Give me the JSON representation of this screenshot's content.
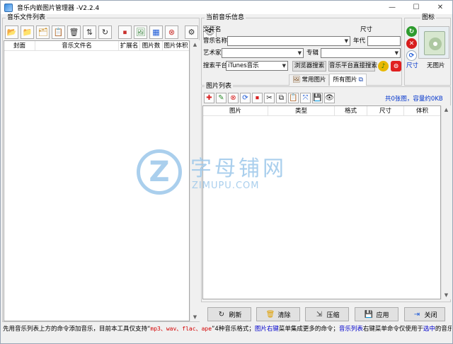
{
  "window": {
    "title": "音乐内嵌图片管理器 -V2.2.4",
    "min": "—",
    "max": "☐",
    "close": "✕"
  },
  "left_panel": {
    "legend": "音乐文件列表",
    "toolbar": [
      {
        "icon": "add-file-icon",
        "glyph": "📂"
      },
      {
        "icon": "add-folder-icon",
        "glyph": "📁"
      },
      {
        "icon": "add-folders-icon",
        "glyph": "🗂"
      },
      {
        "icon": "clipboard-icon",
        "glyph": "📋"
      },
      {
        "icon": "trash-icon",
        "glyph": "🗑"
      },
      {
        "icon": "sort-icon",
        "glyph": "⇅"
      },
      {
        "icon": "refresh-icon",
        "glyph": "↻"
      },
      {
        "icon": "stop-icon",
        "glyph": "⏹"
      },
      {
        "icon": "image-add-icon",
        "glyph": "🖼"
      },
      {
        "icon": "grid-select-icon",
        "glyph": "▦"
      },
      {
        "icon": "image-remove-icon",
        "glyph": "⊗"
      },
      {
        "icon": "gear-icon",
        "glyph": "⚙"
      },
      {
        "icon": "eye-icon",
        "glyph": "👁"
      }
    ],
    "columns": [
      "封面",
      "音乐文件名",
      "扩展名",
      "图片数",
      "图片体积"
    ]
  },
  "info_panel": {
    "legend": "当前音乐信息",
    "file_name_label": "文件名",
    "size_label": "尺寸",
    "music_name_label": "音乐名称",
    "music_name_value": "",
    "year_label": "年代",
    "year_value": "",
    "artist_label": "艺术家",
    "artist_value": "",
    "album_label": "专辑",
    "album_value": "",
    "search_platform_label": "搜索平台",
    "search_platform_value": "iTunes音乐",
    "browser_search_label": "浏览器搜索",
    "platform_direct_search_label": "音乐平台直接搜索",
    "tabs": [
      {
        "label": "常用图片",
        "active": false
      },
      {
        "label": "所有图片",
        "active": true
      }
    ]
  },
  "cover_panel": {
    "legend": "图标",
    "size_label": "尺寸",
    "no_image_label": "无图片"
  },
  "image_list": {
    "legend": "图片列表",
    "summary": "共0张图，容量约0KB",
    "toolbar": [
      {
        "icon": "plus-icon",
        "glyph": "✚",
        "color": "#d81e1e"
      },
      {
        "icon": "edit-icon",
        "glyph": "✎",
        "color": "#2e8b2e"
      },
      {
        "icon": "delete-icon",
        "glyph": "⊗",
        "color": "#d81e1e"
      },
      {
        "icon": "link-icon",
        "glyph": "⟳",
        "color": "#1e5bd8"
      },
      {
        "icon": "stop-icon",
        "glyph": "⏹",
        "color": "#d81e1e"
      },
      {
        "icon": "cut-icon",
        "glyph": "✂",
        "color": "#222"
      },
      {
        "icon": "copy-icon",
        "glyph": "⧉",
        "color": "#222"
      },
      {
        "icon": "paste-icon",
        "glyph": "📋",
        "color": "#222"
      },
      {
        "icon": "crop-icon",
        "glyph": "⤧",
        "color": "#1e5bd8"
      },
      {
        "icon": "save-icon",
        "glyph": "💾",
        "color": "#222"
      },
      {
        "icon": "eye-icon",
        "glyph": "👁",
        "color": "#222"
      }
    ],
    "columns": [
      "图片",
      "类型",
      "格式",
      "尺寸",
      "体积"
    ]
  },
  "bottom_buttons": [
    {
      "label": "刷新",
      "icon": "refresh-icon",
      "glyph": "↻"
    },
    {
      "label": "清除",
      "icon": "trash-icon",
      "glyph": "🗑"
    },
    {
      "label": "压缩",
      "icon": "compress-icon",
      "glyph": "⇲"
    },
    {
      "label": "应用",
      "icon": "save-icon",
      "glyph": "💾"
    },
    {
      "label": "关闭",
      "icon": "exit-icon",
      "glyph": "⇥"
    }
  ],
  "status": {
    "part1": "先用音乐列表上方的命令添加音乐，目前本工具仅支持“",
    "formats": "mp3、wav、flac、ape",
    "part2": "”4种音乐格式；",
    "link1": "图片右键",
    "part3": "菜单集成更多的命令；",
    "link2": "音乐列表",
    "part4": "右键菜单命令仅使用于",
    "link3": "选中",
    "part5": "的音乐！"
  },
  "watermark": {
    "logo": "Z",
    "cn": "字母铺网",
    "en": "ZIMUPU.COM"
  }
}
